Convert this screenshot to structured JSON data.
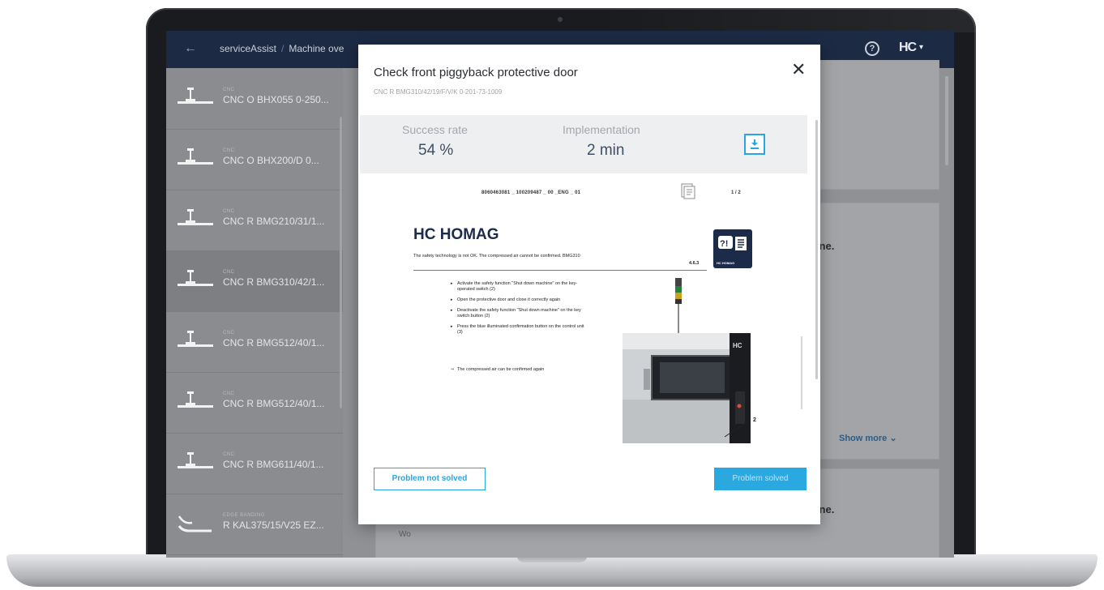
{
  "app": {
    "breadcrumb": [
      "serviceAssist",
      "Machine ove"
    ],
    "help_glyph": "?",
    "brand_glyph": "HC",
    "brand_caret": "▾",
    "back_glyph": "←"
  },
  "sidebar": {
    "items": [
      {
        "category": "CNC",
        "name": "CNC O BHX055 0-250...",
        "icon": "cnc-machine-icon"
      },
      {
        "category": "CNC",
        "name": "CNC O BHX200/D 0...",
        "icon": "cnc-machine-icon"
      },
      {
        "category": "CNC",
        "name": "CNC R BMG210/31/1...",
        "icon": "cnc-machine-icon"
      },
      {
        "category": "CNC",
        "name": "CNC R BMG310/42/1...",
        "icon": "cnc-machine-icon",
        "active": true
      },
      {
        "category": "CNC",
        "name": "CNC R BMG512/40/1...",
        "icon": "cnc-machine-icon"
      },
      {
        "category": "CNC",
        "name": "CNC R BMG512/40/1...",
        "icon": "cnc-machine-icon"
      },
      {
        "category": "CNC",
        "name": "CNC R BMG611/40/1...",
        "icon": "cnc-machine-icon"
      },
      {
        "category": "EDGE BANDING",
        "name": "R KAL375/15/V25 EZ...",
        "icon": "edgebander-icon"
      }
    ]
  },
  "background": {
    "card1_text": "hine.",
    "card2_show_more": "Show more",
    "card3_text": "hine.",
    "bottom_text": "Wo"
  },
  "modal": {
    "title": "Check front piggyback protective door",
    "subtitle": "CNC R BMG310/42/19/F/V/K 0-201-73-1009",
    "close_glyph": "✕",
    "stats": {
      "success_label": "Success rate",
      "success_value": "54 %",
      "implementation_label": "Implementation",
      "implementation_value": "2 min"
    },
    "document": {
      "doc_id": "8060463081 _ 100209487 _ 00 _ENG _ 01",
      "page": "1 / 2",
      "logo_text": "HOMAG",
      "logo_mark": "HC",
      "badge_text": "HC HOMAG",
      "badge_glyph": "?!",
      "status": "The safety technology is not OK. The compressed air cannot be confirmed. BMG310",
      "section_number": "4.6.3",
      "steps": [
        "Activate the safety function \"Shut down machine\" on the key-operated switch (2)",
        "Open the protective door and close it correctly again",
        "Deactivate the safety function \"Shut down machine\" on the key switch button (2)",
        "Press the blue illuminated confirmation button on the control unit (3)"
      ],
      "result": "The compressed air can be confirmed again",
      "callout": "2"
    },
    "buttons": {
      "not_solved": "Problem not solved",
      "solved": "Problem solved"
    }
  },
  "colors": {
    "topbar": "#1d2a44",
    "accent": "#29a6df",
    "homag_navy": "#1c2b4a",
    "stats_value": "#3f4f66"
  }
}
